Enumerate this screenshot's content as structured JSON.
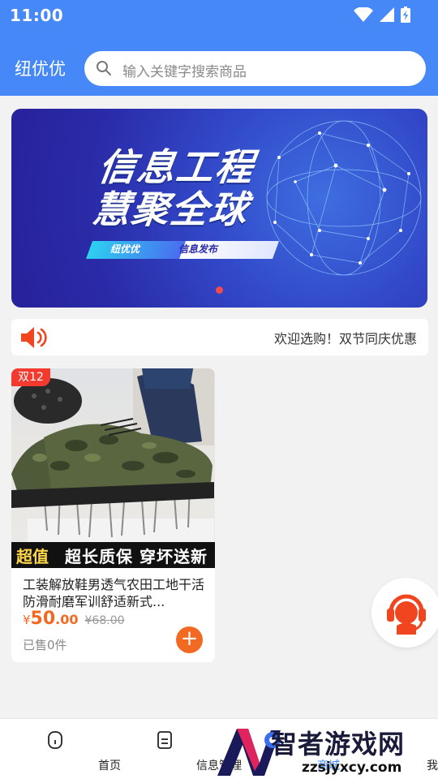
{
  "status_bar": {
    "time": "11:00"
  },
  "header": {
    "title": "纽优优",
    "search_placeholder": "输入关键字搜索商品"
  },
  "banner": {
    "headline_line1": "信息工程",
    "headline_line2": "慧聚全球",
    "tag_left": "纽优优",
    "tag_right": "信息发布"
  },
  "notice": {
    "text": "欢迎选购！双节同庆优惠"
  },
  "product": {
    "badge": "双12",
    "promo_left": "超值",
    "promo_right": "超长质保  穿坏送新",
    "title": "工装解放鞋男透气农田工地干活防滑耐磨军训舒适新式...",
    "price_symbol": "¥",
    "price_main": "50",
    "price_decimal": ".00",
    "price_original": "¥68.00",
    "sold": "已售0件"
  },
  "tabs": [
    {
      "label": "首页"
    },
    {
      "label": "信息管理"
    },
    {
      "label": "商城"
    },
    {
      "label": "我的"
    }
  ],
  "watermark": {
    "title": "智者游戏网",
    "url": "zzsjyxcy.com"
  },
  "colors": {
    "primary": "#4688f7",
    "accent": "#f26a21",
    "badge": "#f23a2f"
  }
}
